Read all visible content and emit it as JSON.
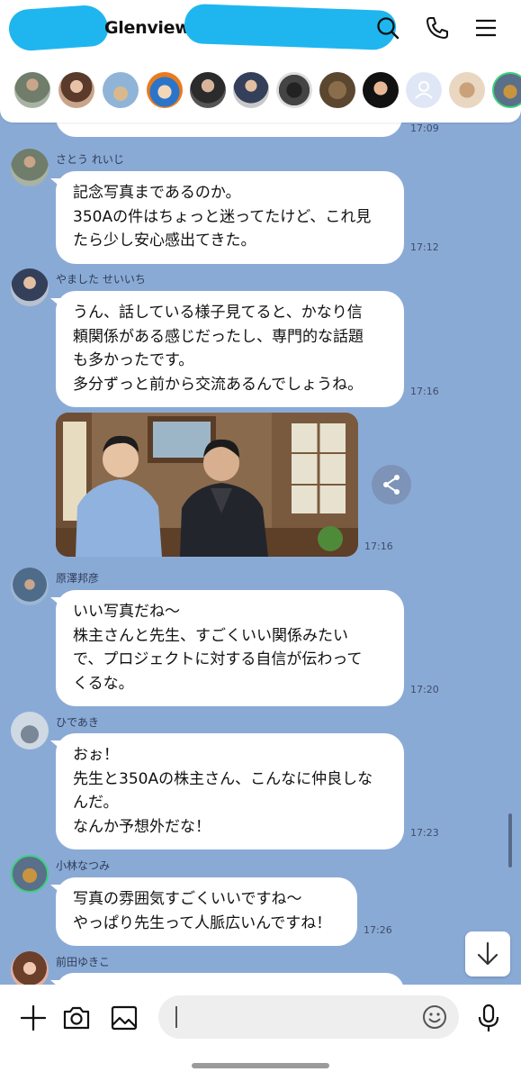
{
  "header": {
    "title": "Glenview",
    "scribble_color": "#1fb6ef",
    "icons": [
      "back-icon",
      "search-icon",
      "phone-icon",
      "menu-icon"
    ]
  },
  "members": {
    "count_visible": 12,
    "icons": [
      "member-avatar",
      "default-avatar-icon"
    ]
  },
  "chat": {
    "background": "#8aaad6",
    "previous_time": "17:09",
    "messages": [
      {
        "sender": "さとう れいじ",
        "lines": [
          "記念写真まであるのか。",
          "350Aの件はちょっと迷ってたけど、これ見",
          "たら少し安心感出てきた。"
        ],
        "time": "17:12"
      },
      {
        "sender": "やました せいいち",
        "lines": [
          "うん、話している様子見てると、かなり信",
          "頼関係がある感じだったし、専門的な話題",
          "も多かったです。",
          "多分ずっと前から交流あるんでしょうね。"
        ],
        "time": "17:16"
      },
      {
        "sender": "",
        "photo": "two-men-seated-photo",
        "time": "17:16"
      },
      {
        "sender": "原澤邦彦",
        "lines": [
          "いい写真だね～",
          "株主さんと先生、すごくいい関係みたい",
          "で、プロジェクトに対する自信が伝わって",
          "くるな。"
        ],
        "time": "17:20"
      },
      {
        "sender": "ひであき",
        "lines": [
          "おぉ！",
          "先生と350Aの株主さん、こんなに仲良しな",
          "んだ。",
          "なんか予想外だな！"
        ],
        "time": "17:23"
      },
      {
        "sender": "小林なつみ",
        "lines": [
          "写真の雰囲気すごくいいですね～",
          "やっぱり先生って人脈広いんですね！"
        ],
        "time": "17:26"
      },
      {
        "sender": "前田ゆきこ",
        "lines": [],
        "time": ""
      }
    ]
  },
  "input": {
    "placeholder": "",
    "icons": [
      "plus-icon",
      "camera-icon",
      "image-icon",
      "emoji-icon",
      "mic-icon"
    ]
  },
  "colors": {
    "accent_scribble": "#1fb6ef",
    "chat_bg": "#8aaad6",
    "bubble": "#ffffff"
  }
}
